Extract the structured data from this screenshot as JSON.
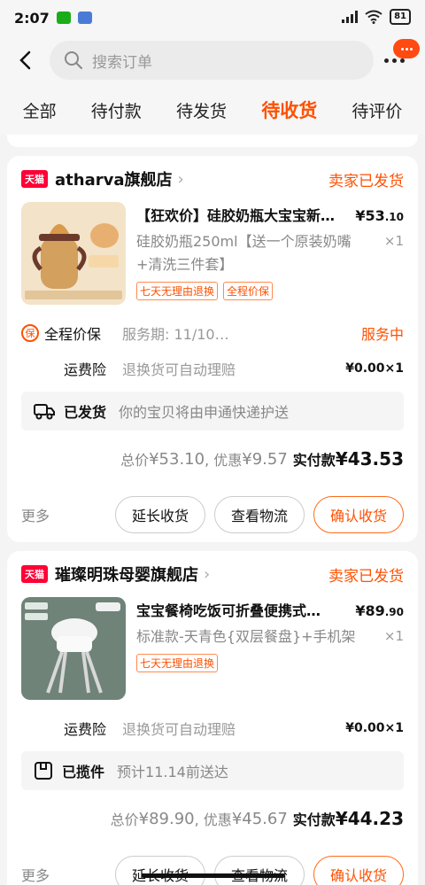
{
  "status_bar": {
    "time": "2:07",
    "battery": "81"
  },
  "header": {
    "search_placeholder": "搜索订单"
  },
  "tabs": [
    {
      "label": "全部"
    },
    {
      "label": "待付款"
    },
    {
      "label": "待发货"
    },
    {
      "label": "待收货"
    },
    {
      "label": "待评价"
    }
  ],
  "orders": [
    {
      "shop_badge": "天猫",
      "shop": "atharva旗舰店",
      "status": "卖家已发货",
      "title": "【狂欢价】硅胶奶瓶大宝宝新…",
      "sku": "硅胶奶瓶250ml【送一个原装奶嘴+清洗三件套】",
      "price_yen": "¥53",
      "price_dec": ".10",
      "qty": "×1",
      "tags": [
        "七天无理由退换",
        "全程价保"
      ],
      "service_badge": "保",
      "service_label": "全程价保",
      "service_desc": "服务期: 11/10…",
      "service_val": "服务中",
      "insurance_label": "运费险",
      "insurance_desc": "退换货可自动理赔",
      "insurance_val": "¥0.00×1",
      "ship_label": "已发货",
      "ship_desc": "你的宝贝将由申通快递护送",
      "total_label": "总价",
      "total": "¥53.10",
      "discount_label": ", 优惠",
      "discount": "¥9.57",
      "paid_label": "实付款",
      "paid": "¥43.53",
      "more": "更多",
      "btn_extend": "延长收货",
      "btn_track": "查看物流",
      "btn_confirm": "确认收货"
    },
    {
      "shop_badge": "天猫",
      "shop": "璀璨明珠母婴旗舰店",
      "status": "卖家已发货",
      "title": "宝宝餐椅吃饭可折叠便携式…",
      "sku": "标准款-天青色{双层餐盘}+手机架",
      "price_yen": "¥89",
      "price_dec": ".90",
      "qty": "×1",
      "tags": [
        "七天无理由退换"
      ],
      "insurance_label": "运费险",
      "insurance_desc": "退换货可自动理赔",
      "insurance_val": "¥0.00×1",
      "ship_label": "已揽件",
      "ship_desc": "预计11.14前送达",
      "total_label": "总价",
      "total": "¥89.90",
      "discount_label": ", 优惠",
      "discount": "¥45.67",
      "paid_label": "实付款",
      "paid": "¥44.23",
      "more": "更多",
      "btn_extend": "延长收货",
      "btn_track": "查看物流",
      "btn_confirm": "确认收货"
    }
  ],
  "colors": {
    "accent": "#ff5000",
    "tmall": "#ff0036"
  }
}
